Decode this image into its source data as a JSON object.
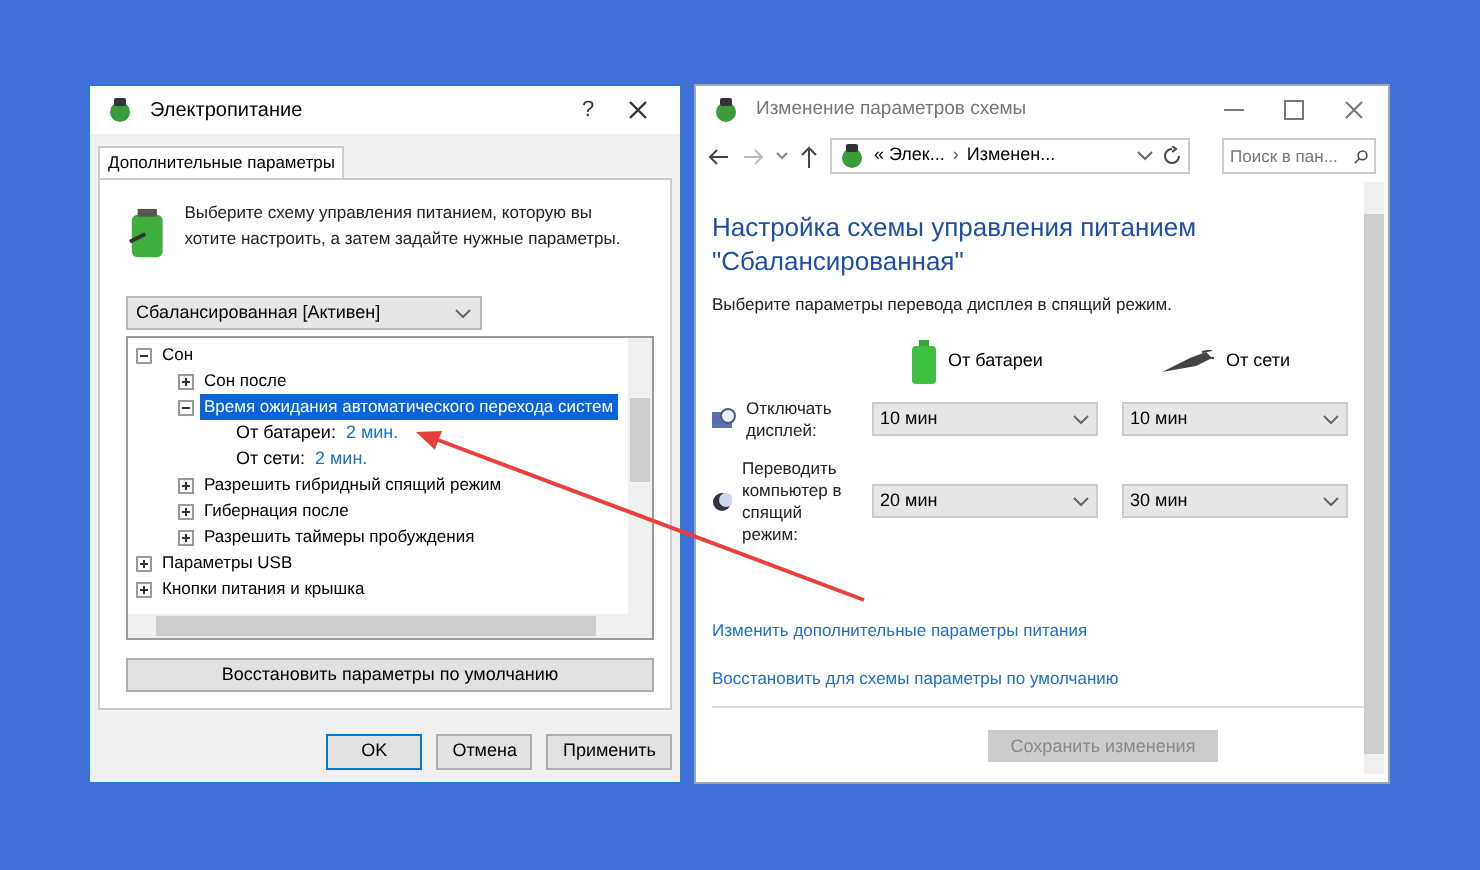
{
  "left_window": {
    "title": "Электропитание",
    "help": "?",
    "tabs": [
      {
        "label": "Дополнительные параметры",
        "selected": true
      }
    ],
    "intro": "Выберите схему управления питанием, которую вы хотите настроить, а затем задайте нужные параметры.",
    "scheme": {
      "value": "Сбалансированная [Активен]"
    },
    "tree": [
      {
        "label": "Сон",
        "expanded": true,
        "selected": false,
        "children": [
          {
            "label": "Сон после",
            "expanded": false,
            "selected": false
          },
          {
            "label": "Время ожидания автоматического перехода систем",
            "expanded": true,
            "selected": true,
            "children": [
              {
                "label": "От батареи:",
                "value": "2 мин."
              },
              {
                "label": "От сети:",
                "value": "2 мин."
              }
            ]
          },
          {
            "label": "Разрешить гибридный спящий режим",
            "expanded": false,
            "selected": false
          },
          {
            "label": "Гибернация после",
            "expanded": false,
            "selected": false
          },
          {
            "label": "Разрешить таймеры пробуждения",
            "expanded": false,
            "selected": false
          }
        ]
      },
      {
        "label": "Параметры USB",
        "expanded": false,
        "selected": false
      },
      {
        "label": "Кнопки питания и крышка",
        "expanded": false,
        "selected": false
      }
    ],
    "restore_button": "Восстановить параметры по умолчанию",
    "buttons": [
      {
        "label": "OK",
        "default": true
      },
      {
        "label": "Отмена",
        "default": false
      },
      {
        "label": "Применить",
        "default": false
      }
    ]
  },
  "right_window": {
    "title": "Изменение параметров схемы",
    "breadcrumb": [
      "« Элек...",
      "Изменен..."
    ],
    "breadcrumb_separator": "›",
    "search": {
      "placeholder": "Поиск в пан..."
    },
    "heading": "Настройка схемы управления питанием \"Сбалансированная\"",
    "subtitle": "Выберите параметры перевода дисплея в спящий режим.",
    "columns": [
      {
        "kind": "battery",
        "label": "От батареи"
      },
      {
        "kind": "plug",
        "label": "От сети"
      }
    ],
    "settings": [
      {
        "kind": "display",
        "label": "Отключать дисплей:",
        "values": [
          "10 мин",
          "10 мин"
        ]
      },
      {
        "kind": "sleep",
        "label": "Переводить компьютер в спящий режим:",
        "values": [
          "20 мин",
          "30 мин"
        ]
      }
    ],
    "links": [
      "Изменить дополнительные параметры питания",
      "Восстановить для схемы параметры по умолчанию"
    ],
    "save_button": {
      "label": "Сохранить изменения",
      "disabled": true
    }
  }
}
